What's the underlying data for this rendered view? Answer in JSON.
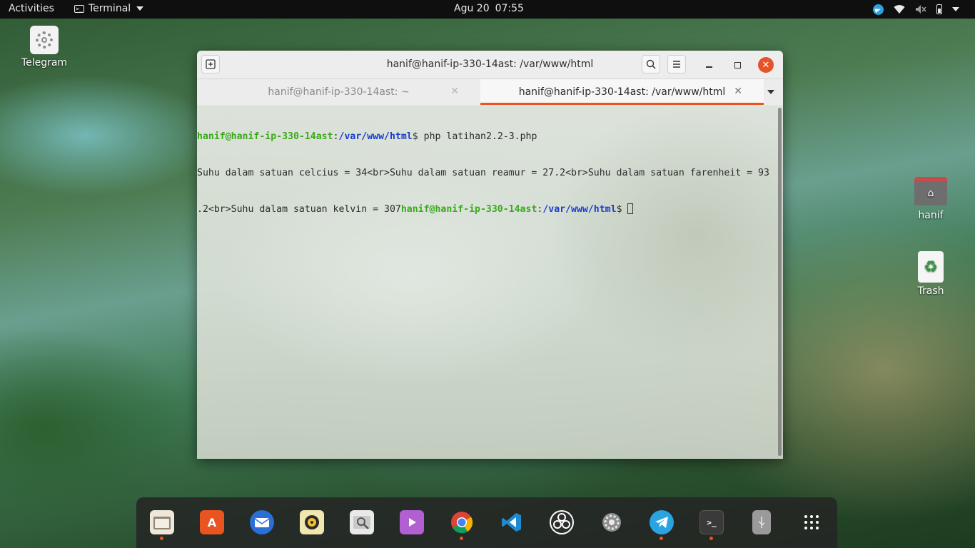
{
  "topbar": {
    "activities": "Activities",
    "app_name": "Terminal",
    "date": "Agu 20",
    "time": "07:55"
  },
  "desktop_icons": {
    "telegram": "Telegram",
    "home": "hanif",
    "trash": "Trash"
  },
  "window": {
    "title": "hanif@hanif-ip-330-14ast: /var/www/html",
    "tabs": [
      {
        "label": "hanif@hanif-ip-330-14ast: ~",
        "active": false
      },
      {
        "label": "hanif@hanif-ip-330-14ast: /var/www/html",
        "active": true
      }
    ]
  },
  "terminal": {
    "prompt_user": "hanif@hanif-ip-330-14ast",
    "prompt_sep": ":",
    "prompt_path": "/var/www/html",
    "prompt_end": "$ ",
    "command": "php latihan2.2-3.php",
    "output_line1": "Suhu dalam satuan celcius = 34<br>Suhu dalam satuan reamur = 27.2<br>Suhu dalam satuan farenheit = 93",
    "output_line2": ".2<br>Suhu dalam satuan kelvin = 307"
  },
  "dock": {
    "items": [
      "files-icon",
      "software-icon",
      "thunderbird-icon",
      "rhythmbox-icon",
      "image-viewer-icon",
      "videos-icon",
      "chrome-icon",
      "vscode-icon",
      "obs-icon",
      "settings-icon",
      "telegram-icon",
      "terminal-icon",
      "usb-drive-icon",
      "show-apps-icon"
    ]
  },
  "colors": {
    "accent": "#e95420",
    "prompt_user": "#3aaa1a",
    "prompt_path": "#1a3ecf"
  }
}
